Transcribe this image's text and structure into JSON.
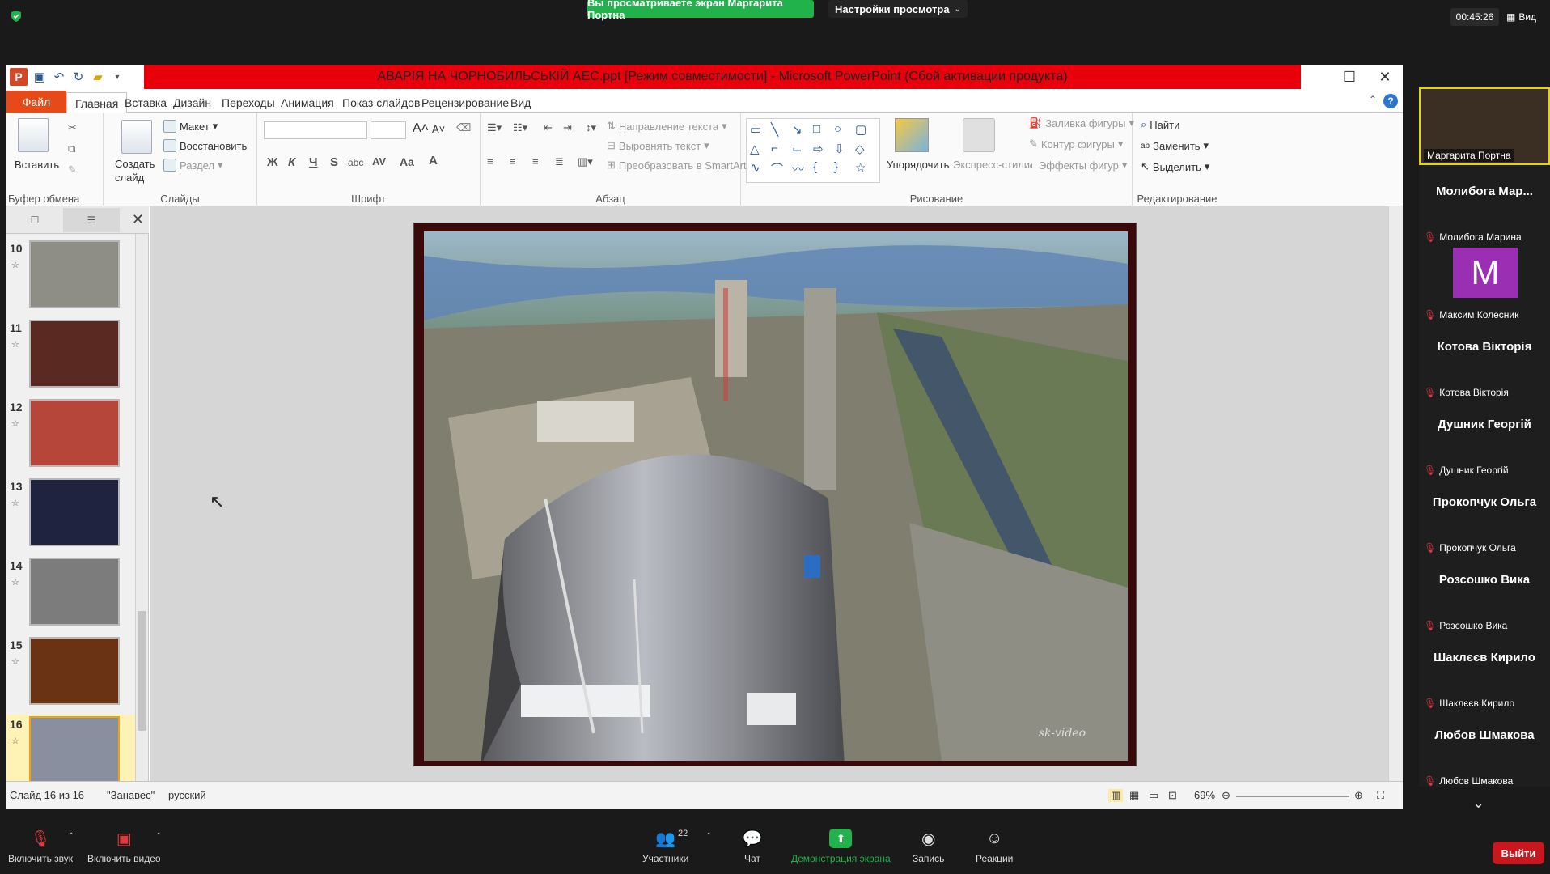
{
  "zoom": {
    "share_banner": "Вы просматриваете экран Маргарита Портна",
    "view_options": "Настройки просмотра",
    "timer": "00:45:26",
    "view_label": "Вид",
    "toolbar": {
      "mute": "Включить звук",
      "video": "Включить видео",
      "participants": "Участники",
      "participants_count": "22",
      "chat": "Чат",
      "share": "Демонстрация экрана",
      "record": "Запись",
      "reactions": "Реакции",
      "end": "Выйти"
    },
    "colors": {
      "share_green": "#22b24c",
      "end_red": "#c9171e",
      "active_border": "#e4d400"
    }
  },
  "participants": [
    {
      "name": "Маргарита Портна",
      "label": "Маргарита Портна",
      "active": true
    },
    {
      "name": "Молибога Мар...",
      "label": "Молибога Марина"
    },
    {
      "name": "M",
      "label": "Максим Колесник",
      "avatar": true
    },
    {
      "name": "Котова Вікторія",
      "label": "Котова Вікторія"
    },
    {
      "name": "Душник Георгій",
      "label": "Душник Георгій"
    },
    {
      "name": "Прокопчук Ольга",
      "label": "Прокопчук Ольга"
    },
    {
      "name": "Розсошко Вика",
      "label": "Розсошко Вика"
    },
    {
      "name": "Шаклєєв Кирило",
      "label": "Шаклєєв Кирило"
    },
    {
      "name": "Любов Шмакова",
      "label": "Любов Шмакова"
    }
  ],
  "ppt": {
    "title": "АВАРІЯ НА ЧОРНОБИЛЬСЬКІЙ АЕС.ppt [Режим совместимости]  -  Microsoft PowerPoint (Сбой активации продукта)",
    "tabs": [
      "Файл",
      "Главная",
      "Вставка",
      "Дизайн",
      "Переходы",
      "Анимация",
      "Показ слайдов",
      "Рецензирование",
      "Вид"
    ],
    "groups": {
      "clipboard": "Буфер обмена",
      "slides": "Слайды",
      "font": "Шрифт",
      "paragraph": "Абзац",
      "drawing": "Рисование",
      "editing": "Редактирование"
    },
    "buttons": {
      "paste": "Вставить",
      "new_slide": "Создать слайд",
      "layout": "Макет",
      "reset": "Восстановить",
      "section": "Раздел",
      "text_direction": "Направление текста",
      "align_text": "Выровнять текст",
      "smartart": "Преобразовать в SmartArt",
      "arrange": "Упорядочить",
      "quick_styles": "Экспресс-стили",
      "shape_fill": "Заливка фигуры",
      "shape_outline": "Контур фигуры",
      "shape_effects": "Эффекты фигур",
      "find": "Найти",
      "replace": "Заменить",
      "select": "Выделить"
    },
    "font_buttons": {
      "bold": "Ж",
      "italic": "К",
      "underline": "Ч",
      "shadow": "S",
      "strike": "abc"
    },
    "slide_numbers": [
      "10",
      "11",
      "12",
      "13",
      "14",
      "15",
      "16"
    ],
    "status": {
      "slide": "Слайд 16 из 16",
      "theme": "\"Занавес\"",
      "lang": "русский",
      "zoom": "69%"
    },
    "slide_watermark": "sk-video"
  }
}
